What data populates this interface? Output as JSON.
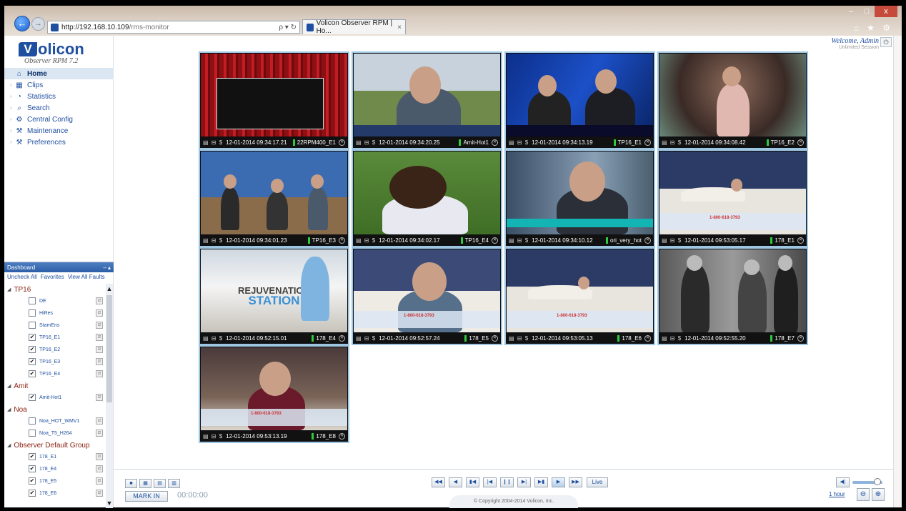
{
  "browser": {
    "url_host": "http://192.168.10.109",
    "url_path": "/rms-monitor",
    "address_tools": "ρ ▾ ↻",
    "tab_title": "Volicon Observer RPM | Ho...",
    "tab_close": "×",
    "window_controls": [
      "‒",
      "□",
      "x"
    ],
    "browser_icons": "⌂ ★ ⚙"
  },
  "logo": {
    "mark": "V",
    "word": "olicon",
    "subtitle": "Observer RPM 7.2"
  },
  "header": {
    "welcome": "Welcome, Admin",
    "session": "Unlimited Session",
    "power_icon": "power-icon"
  },
  "menu": [
    {
      "label": "Home",
      "icon": "home-icon",
      "glyph": "⌂",
      "active": true
    },
    {
      "label": "Clips",
      "icon": "film-icon",
      "glyph": "▦"
    },
    {
      "label": "Statistics",
      "icon": "pie-chart-icon",
      "glyph": "◔"
    },
    {
      "label": "Search",
      "icon": "search-icon",
      "glyph": "⌕"
    },
    {
      "label": "Central Config",
      "icon": "gear-icon",
      "glyph": "⚙"
    },
    {
      "label": "Maintenance",
      "icon": "tools-icon",
      "glyph": "⚒"
    },
    {
      "label": "Preferences",
      "icon": "wrench-icon",
      "glyph": "⚒"
    }
  ],
  "dashboard": {
    "title": "Dashboard",
    "controls": "– ▴",
    "links": [
      "Uncheck All",
      "Favorites",
      "View All Faults"
    ],
    "groups": [
      {
        "name": "TP16",
        "channels": [
          {
            "name": "DE",
            "checked": false
          },
          {
            "name": "HiRes",
            "checked": false
          },
          {
            "name": "StamEns",
            "checked": false
          },
          {
            "name": "TP16_E1",
            "checked": true
          },
          {
            "name": "TP16_E2",
            "checked": true
          },
          {
            "name": "TP16_E3",
            "checked": true
          },
          {
            "name": "TP16_E4",
            "checked": true
          }
        ]
      },
      {
        "name": "Amit",
        "channels": [
          {
            "name": "Amit-Hot1",
            "checked": true
          }
        ]
      },
      {
        "name": "Noa",
        "channels": [
          {
            "name": "Noa_HOT_WMV1",
            "checked": false
          },
          {
            "name": "Noa_T5_H264",
            "checked": false
          }
        ]
      },
      {
        "name": "Observer Default Group",
        "channels": [
          {
            "name": "178_E1",
            "checked": true
          },
          {
            "name": "178_E4",
            "checked": true
          },
          {
            "name": "178_E5",
            "checked": true
          },
          {
            "name": "178_E6",
            "checked": true
          }
        ]
      }
    ]
  },
  "tile_icons": "▤ ⊟ $",
  "tiles": [
    {
      "timestamp": "12-01-2014 09:34:17.21",
      "channel": "22RPM400_E1",
      "scene": "red-curtain-stage"
    },
    {
      "timestamp": "12-01-2014 09:34:20.25",
      "channel": "Amit-Hot1",
      "scene": "man-interview-stadium"
    },
    {
      "timestamp": "12-01-2014 09:34:13.19",
      "channel": "TP16_E1",
      "scene": "news-studio-two-men"
    },
    {
      "timestamp": "12-01-2014 09:34:08.42",
      "channel": "TP16_E2",
      "scene": "woman-on-stage"
    },
    {
      "timestamp": "12-01-2014 09:34:01.23",
      "channel": "TP16_E3",
      "scene": "talk-show-studio"
    },
    {
      "timestamp": "12-01-2014 09:34:02.17",
      "channel": "TP16_E4",
      "scene": "football-player"
    },
    {
      "timestamp": "12-01-2014 09:34:10.12",
      "channel": "ori_very_hot",
      "scene": "man-news-interview"
    },
    {
      "timestamp": "12-01-2014 09:53:05.17",
      "channel": "178_E1",
      "scene": "bedroom-mattress-ad"
    },
    {
      "timestamp": "12-01-2014 09:52:15.01",
      "channel": "178_E4",
      "scene": "rejuvenation-station-ad"
    },
    {
      "timestamp": "12-01-2014 09:52:57.24",
      "channel": "178_E5",
      "scene": "man-mattress-ad"
    },
    {
      "timestamp": "12-01-2014 09:53:05.13",
      "channel": "178_E6",
      "scene": "bedroom-mattress-ad"
    },
    {
      "timestamp": "12-01-2014 09:52:55.20",
      "channel": "178_E7",
      "scene": "black-white-film"
    },
    {
      "timestamp": "12-01-2014 09:53:13.19",
      "channel": "178_E8",
      "scene": "woman-mattress-ad"
    }
  ],
  "tile_overlay_text": {
    "rejuvenation": "REJUVENATION",
    "station": "STATION",
    "phone": "1-800-618-3793"
  },
  "bottombar": {
    "layout_buttons": [
      "■",
      "▦",
      "▤",
      "▥"
    ],
    "mark_in": "MARK IN",
    "timecode": "00:00:00",
    "playback_buttons": [
      "◀◀",
      "◀",
      "▮◀",
      "|◀",
      "❙❙",
      "▶|",
      "▶▮",
      "▶",
      "▶▶"
    ],
    "live": "Live",
    "copyright": "© Copyright 2004-2014 Volicon, Inc.",
    "volume_glyph": "◀)",
    "zoom_label": "1 hour",
    "zoom_out": "⊖",
    "zoom_in": "⊕",
    "volume_level": 0.85
  }
}
